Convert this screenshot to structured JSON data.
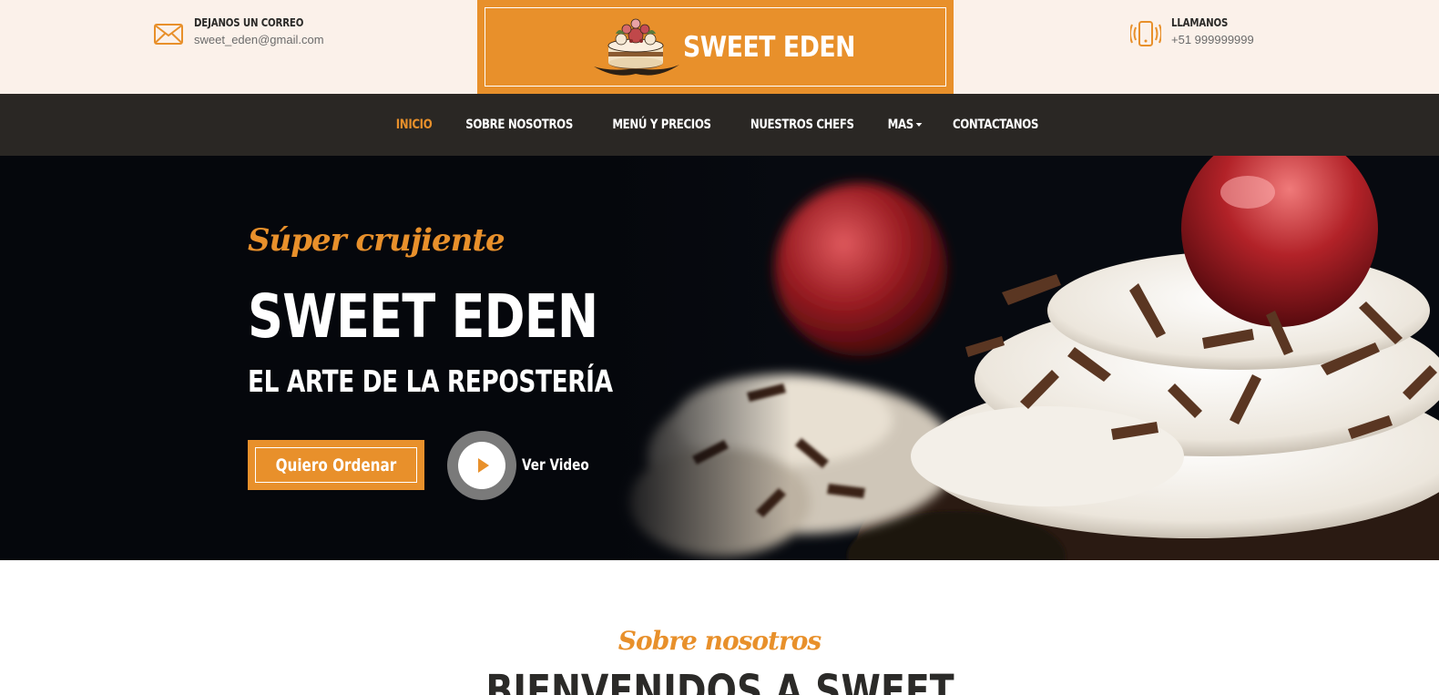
{
  "topbar": {
    "email": {
      "title": "DEJANOS UN CORREO",
      "value": "sweet_eden@gmail.com",
      "icon": "envelope-icon"
    },
    "phone": {
      "title": "LLAMANOS",
      "value": "+51 999999999",
      "icon": "phone-vibrate-icon"
    },
    "logo": {
      "text": "SWEET EDEN",
      "icon": "cake-logo"
    }
  },
  "nav": {
    "items": [
      {
        "label": "INICIO",
        "active": true
      },
      {
        "label": "SOBRE NOSOTROS"
      },
      {
        "label": "MENÚ Y PRECIOS"
      },
      {
        "label": "NUESTROS CHEFS"
      },
      {
        "label": "MAS"
      },
      {
        "label": "CONTACTANOS"
      }
    ]
  },
  "hero": {
    "script": "Súper crujiente",
    "title": "SWEET EDEN",
    "subtitle": "EL ARTE DE LA REPOSTERÍA",
    "order_button": "Quiero Ordenar",
    "video_label": "Ver Video"
  },
  "about": {
    "script": "Sobre nosotros",
    "title": "BIENVENIDOS A SWEET"
  },
  "colors": {
    "accent": "#e8902b",
    "nav_bg": "#2a2724",
    "topbar_bg": "#fbf1ea",
    "text_dark": "#2b2a28"
  }
}
